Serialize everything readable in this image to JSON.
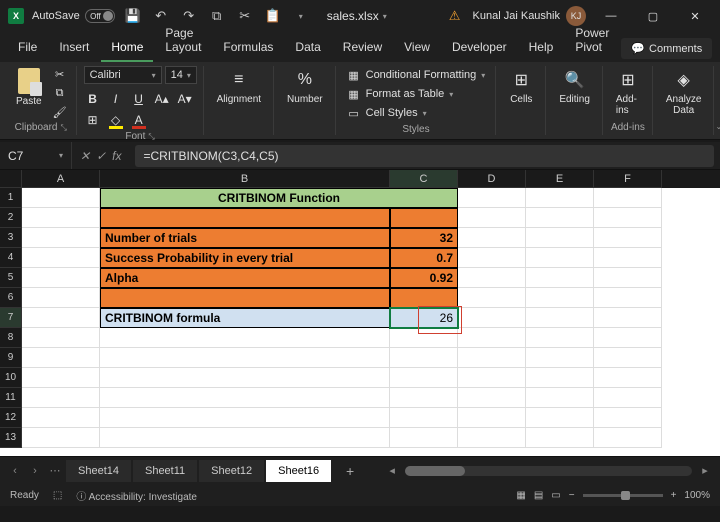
{
  "title": {
    "autosave": "AutoSave",
    "autosave_state": "Off",
    "filename": "sales.xlsx",
    "user": "Kunal Jai Kaushik",
    "initials": "KJ"
  },
  "tabs": [
    "File",
    "Insert",
    "Home",
    "Page Layout",
    "Formulas",
    "Data",
    "Review",
    "View",
    "Developer",
    "Help",
    "Power Pivot"
  ],
  "active_tab": "Home",
  "comments_label": "Comments",
  "ribbon": {
    "paste": "Paste",
    "clipboard": "Clipboard",
    "font_name": "Calibri",
    "font_size": "14",
    "font_label": "Font",
    "alignment": "Alignment",
    "number": "Number",
    "cond_format": "Conditional Formatting",
    "as_table": "Format as Table",
    "cell_styles": "Cell Styles",
    "styles": "Styles",
    "cells": "Cells",
    "editing": "Editing",
    "addins": "Add-ins",
    "analyze": "Analyze Data"
  },
  "fbar": {
    "name_box": "C7",
    "formula": "=CRITBINOM(C3,C4,C5)"
  },
  "cols": [
    "A",
    "B",
    "C",
    "D",
    "E",
    "F"
  ],
  "rows": {
    "r1": {
      "b": "CRITBINOM Function"
    },
    "r3": {
      "b": "Number of trials",
      "c": "32"
    },
    "r4": {
      "b": "Success Probability in every trial",
      "c": "0.7"
    },
    "r5": {
      "b": "Alpha",
      "c": "0.92"
    },
    "r7": {
      "b": "CRITBINOM formula",
      "c": "26"
    }
  },
  "sheets": [
    "Sheet14",
    "Sheet11",
    "Sheet12",
    "Sheet16"
  ],
  "active_sheet": "Sheet16",
  "status": {
    "ready": "Ready",
    "acc": "Accessibility: Investigate",
    "zoom": "100%"
  }
}
